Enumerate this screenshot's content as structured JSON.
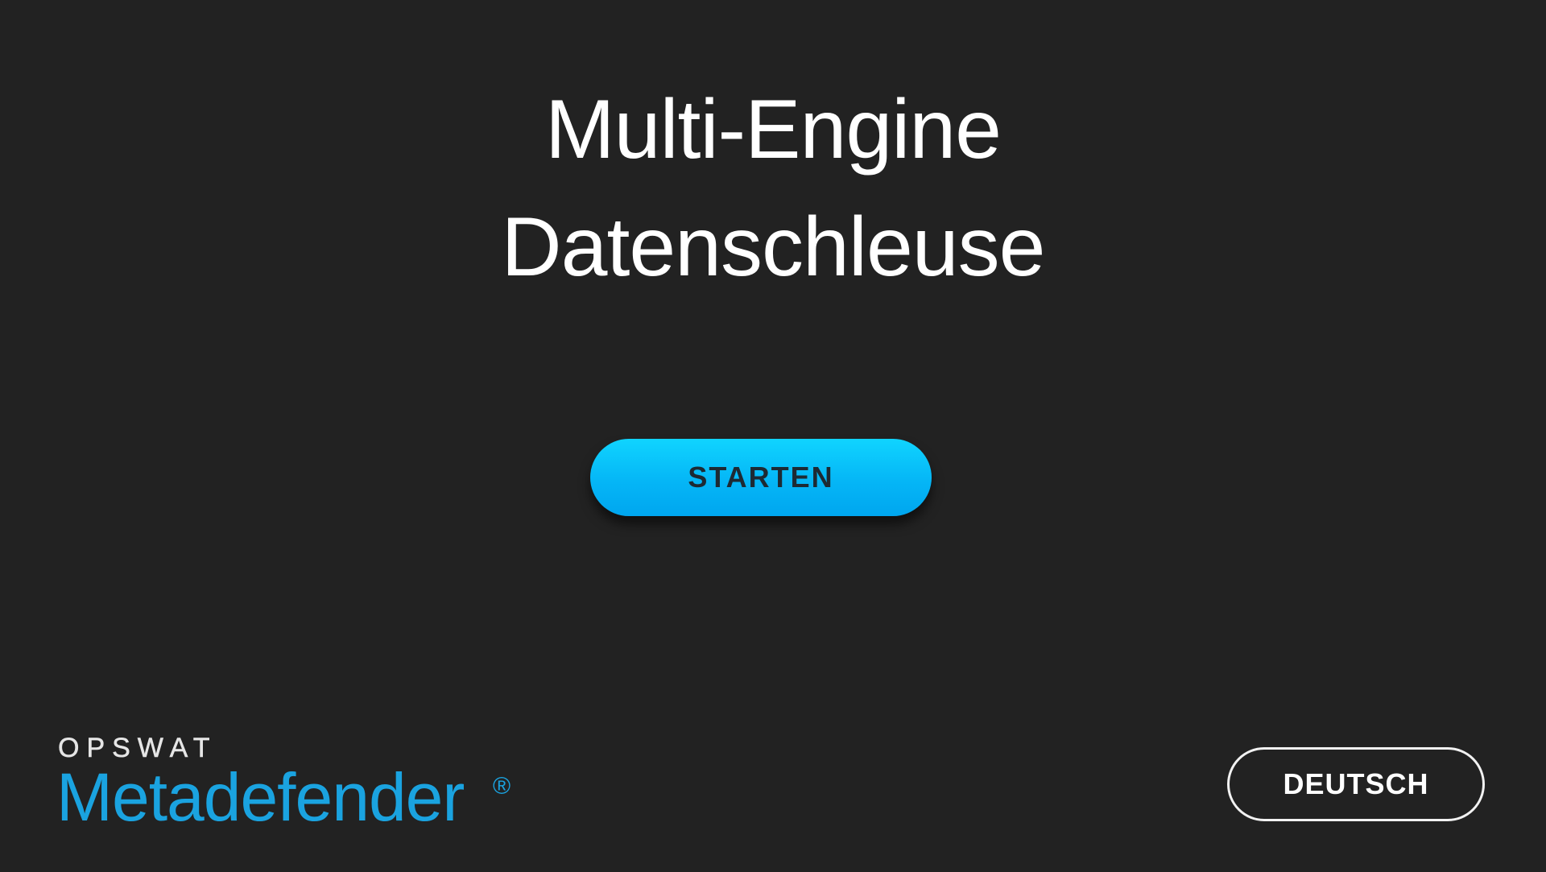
{
  "title": {
    "line1": "Multi-Engine",
    "line2": "Datenschleuse"
  },
  "start_button": {
    "label": "STARTEN"
  },
  "logo": {
    "brand": "OPSWAT",
    "product": "Metadefender",
    "registered_mark": "®"
  },
  "language_button": {
    "label": "DEUTSCH"
  },
  "colors": {
    "background": "#222222",
    "accent": "#05b6f6",
    "logo_blue": "#1aa3e0",
    "text": "#ffffff"
  }
}
